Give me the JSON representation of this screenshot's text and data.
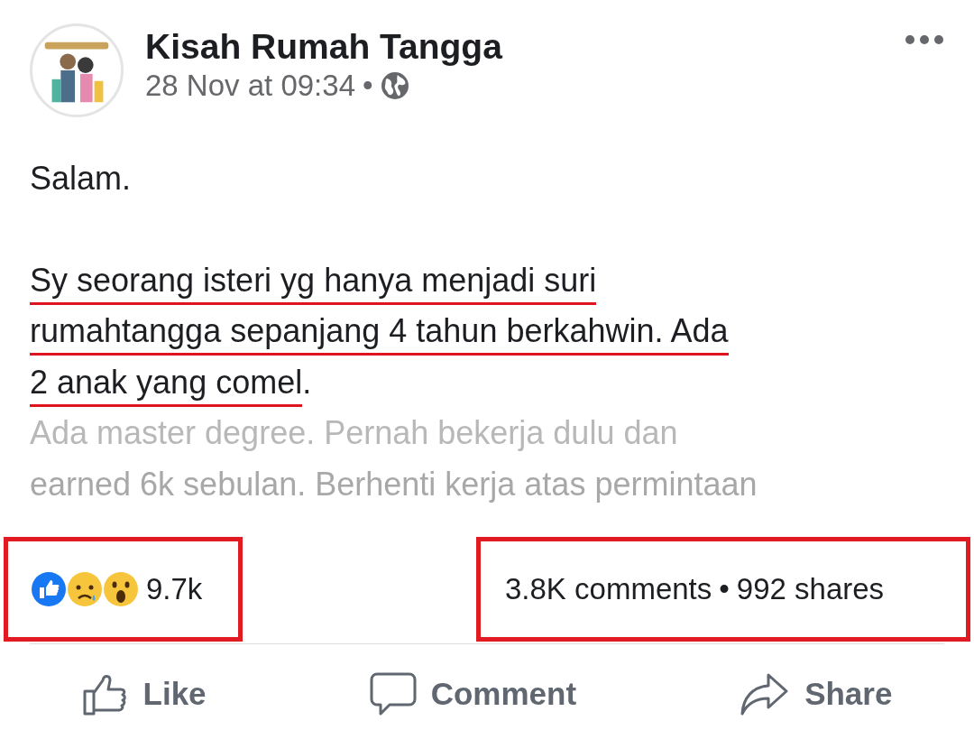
{
  "post": {
    "author": "Kisah Rumah Tangga",
    "timestamp": "28 Nov at 09:34",
    "separator": "•"
  },
  "body": [
    {
      "lines": [
        {
          "text": "Salam.",
          "underlined": false,
          "faded": false
        }
      ]
    },
    {
      "lines": [
        {
          "text": "Sy seorang isteri yg hanya menjadi suri",
          "underlined": true,
          "faded": false
        },
        {
          "text": "rumahtangga sepanjang 4 tahun berkahwin. Ada",
          "underlined": true,
          "faded": false
        },
        {
          "text": "2 anak yang comel",
          "underlined": true,
          "faded": false,
          "tail": "."
        },
        {
          "text": "Ada master degree. Pernah bekerja dulu dan",
          "underlined": false,
          "faded": true
        },
        {
          "text": "earned 6k sebulan. Berhenti kerja atas permintaan",
          "underlined": false,
          "faded": true
        }
      ]
    }
  ],
  "reactions": {
    "count": "9.7k",
    "highlighted": true
  },
  "engagement": {
    "comments": "3.8K comments",
    "separator": "•",
    "shares": "992 shares",
    "highlighted": true
  },
  "actions": [
    {
      "kind": "like",
      "label": "Like"
    },
    {
      "kind": "comment",
      "label": "Comment"
    },
    {
      "kind": "share",
      "label": "Share"
    }
  ]
}
